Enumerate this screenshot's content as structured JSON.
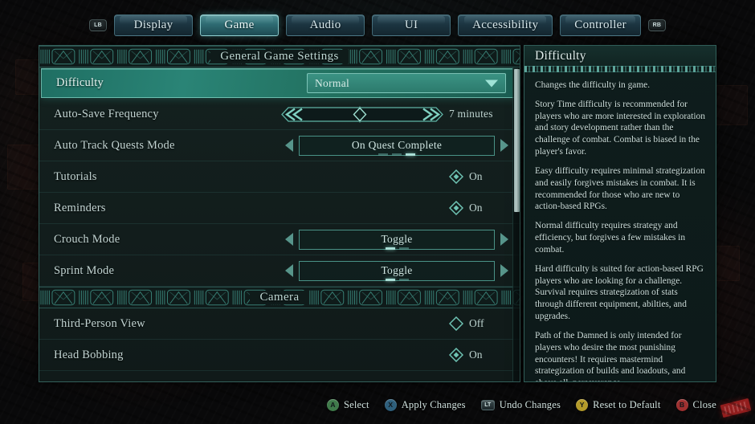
{
  "tabbar": {
    "left_bumper": "LB",
    "right_bumper": "RB",
    "tabs": [
      {
        "label": "Display",
        "active": false
      },
      {
        "label": "Game",
        "active": true
      },
      {
        "label": "Audio",
        "active": false
      },
      {
        "label": "UI",
        "active": false
      },
      {
        "label": "Accessibility",
        "active": false
      },
      {
        "label": "Controller",
        "active": false
      }
    ]
  },
  "settings": {
    "section_title": "General Game Settings",
    "camera_section_title": "Camera",
    "rows": [
      {
        "label": "Difficulty",
        "type": "dropdown",
        "value": "Normal",
        "selected": true
      },
      {
        "label": "Auto-Save Frequency",
        "type": "slider",
        "value": "7 minutes"
      },
      {
        "label": "Auto Track Quests Mode",
        "type": "stepper",
        "value": "On Quest Complete",
        "dots": 3,
        "dot_active": 2
      },
      {
        "label": "Tutorials",
        "type": "toggle",
        "value": "On",
        "on": true
      },
      {
        "label": "Reminders",
        "type": "toggle",
        "value": "On",
        "on": true
      },
      {
        "label": "Crouch Mode",
        "type": "stepper",
        "value": "Toggle",
        "dots": 2,
        "dot_active": 0
      },
      {
        "label": "Sprint Mode",
        "type": "stepper",
        "value": "Toggle",
        "dots": 2,
        "dot_active": 0
      }
    ],
    "camera_rows": [
      {
        "label": "Third-Person View",
        "type": "toggle",
        "value": "Off",
        "on": false
      },
      {
        "label": "Head Bobbing",
        "type": "toggle",
        "value": "On",
        "on": true
      }
    ]
  },
  "info": {
    "title": "Difficulty",
    "paragraphs": [
      "Changes the difficulty in game.",
      "Story Time difficulty is recommended for players who are more interested in exploration and story development rather than the challenge of combat. Combat is biased in the player's favor.",
      "Easy difficulty requires minimal strategization and easily forgives mistakes in combat. It is recommended for those who are new to action-based RPGs.",
      "Normal difficulty requires strategy and efficiency, but forgives a few mistakes in combat.",
      "Hard difficulty is suited for action-based RPG players who are looking for a challenge. Survival requires strategization of stats through different equipment, abilties, and upgrades.",
      "Path of the Damned is only intended for players who desire the most punishing encounters! It requires mastermind strategization of builds and loadouts, and above all, perseverance."
    ]
  },
  "prompts": [
    {
      "button": "A",
      "label": "Select",
      "color": "#3f7a4a"
    },
    {
      "button": "X",
      "label": "Apply Changes",
      "color": "#2e5f7c"
    },
    {
      "button": "LT",
      "label": "Undo Changes",
      "color": "#2b3a3d"
    },
    {
      "button": "Y",
      "label": "Reset to Default",
      "color": "#b49b2a"
    },
    {
      "button": "B",
      "label": "Close",
      "color": "#9e3030"
    }
  ],
  "colors": {
    "accent": "#4fbda9",
    "panel_border": "#4e968c",
    "selected_row": "#2a8476",
    "text": "#cddedb"
  }
}
